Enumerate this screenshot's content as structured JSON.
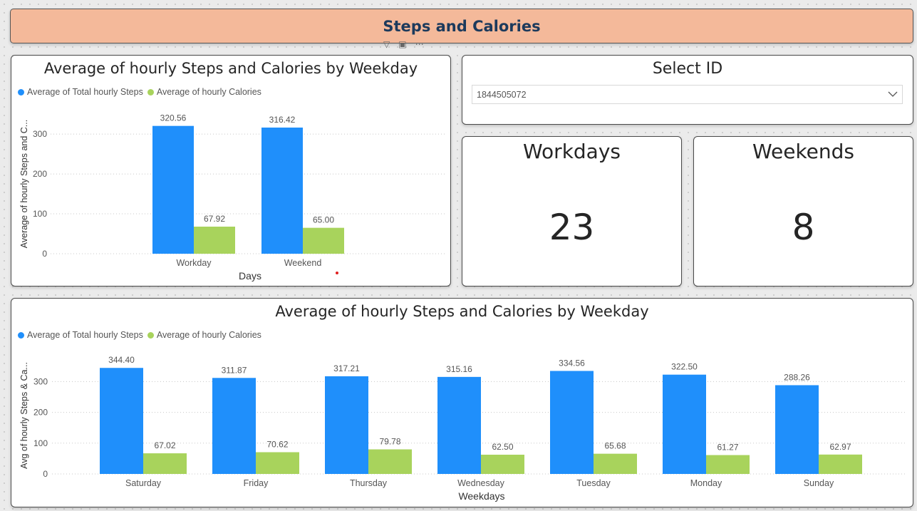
{
  "banner": {
    "title": "Steps and Calories"
  },
  "chart1": {
    "title": "Average of hourly Steps and Calories by Weekday",
    "legend": [
      {
        "label": "Average of Total hourly Steps",
        "color": "#1f8ffb"
      },
      {
        "label": "Average of hourly Calories",
        "color": "#a8d35c"
      }
    ],
    "ylabel": "Average of hourly Steps and C...",
    "xlabel": "Days"
  },
  "chart2": {
    "title": "Average of hourly Steps and Calories by Weekday",
    "legend": [
      {
        "label": "Average of Total hourly Steps",
        "color": "#1f8ffb"
      },
      {
        "label": "Average of hourly Calories",
        "color": "#a8d35c"
      }
    ],
    "ylabel": "Avg of hourly Steps & Ca...",
    "xlabel": "Weekdays"
  },
  "slicer": {
    "title": "Select ID",
    "selected": "1844505072"
  },
  "cards": {
    "workdays": {
      "label": "Workdays",
      "value": "23"
    },
    "weekends": {
      "label": "Weekends",
      "value": "8"
    }
  },
  "chart_data": [
    {
      "type": "bar",
      "title": "Average of hourly Steps and Calories by Weekday",
      "xlabel": "Days",
      "ylabel": "Average of hourly Steps and C...",
      "categories": [
        "Workday",
        "Weekend"
      ],
      "series": [
        {
          "name": "Average of Total hourly Steps",
          "color": "#1f8ffb",
          "values": [
            320.56,
            316.42
          ]
        },
        {
          "name": "Average of hourly Calories",
          "color": "#a8d35c",
          "values": [
            67.92,
            65.0
          ]
        }
      ],
      "ylim": [
        0,
        345
      ],
      "yticks": [
        0,
        100,
        200,
        300
      ],
      "grid": true,
      "legend": "top-left"
    },
    {
      "type": "bar",
      "title": "Average of hourly Steps and Calories by Weekday",
      "xlabel": "Weekdays",
      "ylabel": "Avg of hourly Steps & Ca...",
      "categories": [
        "Saturday",
        "Friday",
        "Thursday",
        "Wednesday",
        "Tuesday",
        "Monday",
        "Sunday"
      ],
      "series": [
        {
          "name": "Average of Total hourly Steps",
          "color": "#1f8ffb",
          "values": [
            344.4,
            311.87,
            317.21,
            315.16,
            334.56,
            322.5,
            288.26
          ]
        },
        {
          "name": "Average of hourly Calories",
          "color": "#a8d35c",
          "values": [
            67.02,
            70.62,
            79.78,
            62.5,
            65.68,
            61.27,
            62.97
          ]
        }
      ],
      "ylim": [
        0,
        375
      ],
      "yticks": [
        0,
        100,
        200,
        300
      ],
      "grid": true,
      "legend": "top-left"
    }
  ]
}
